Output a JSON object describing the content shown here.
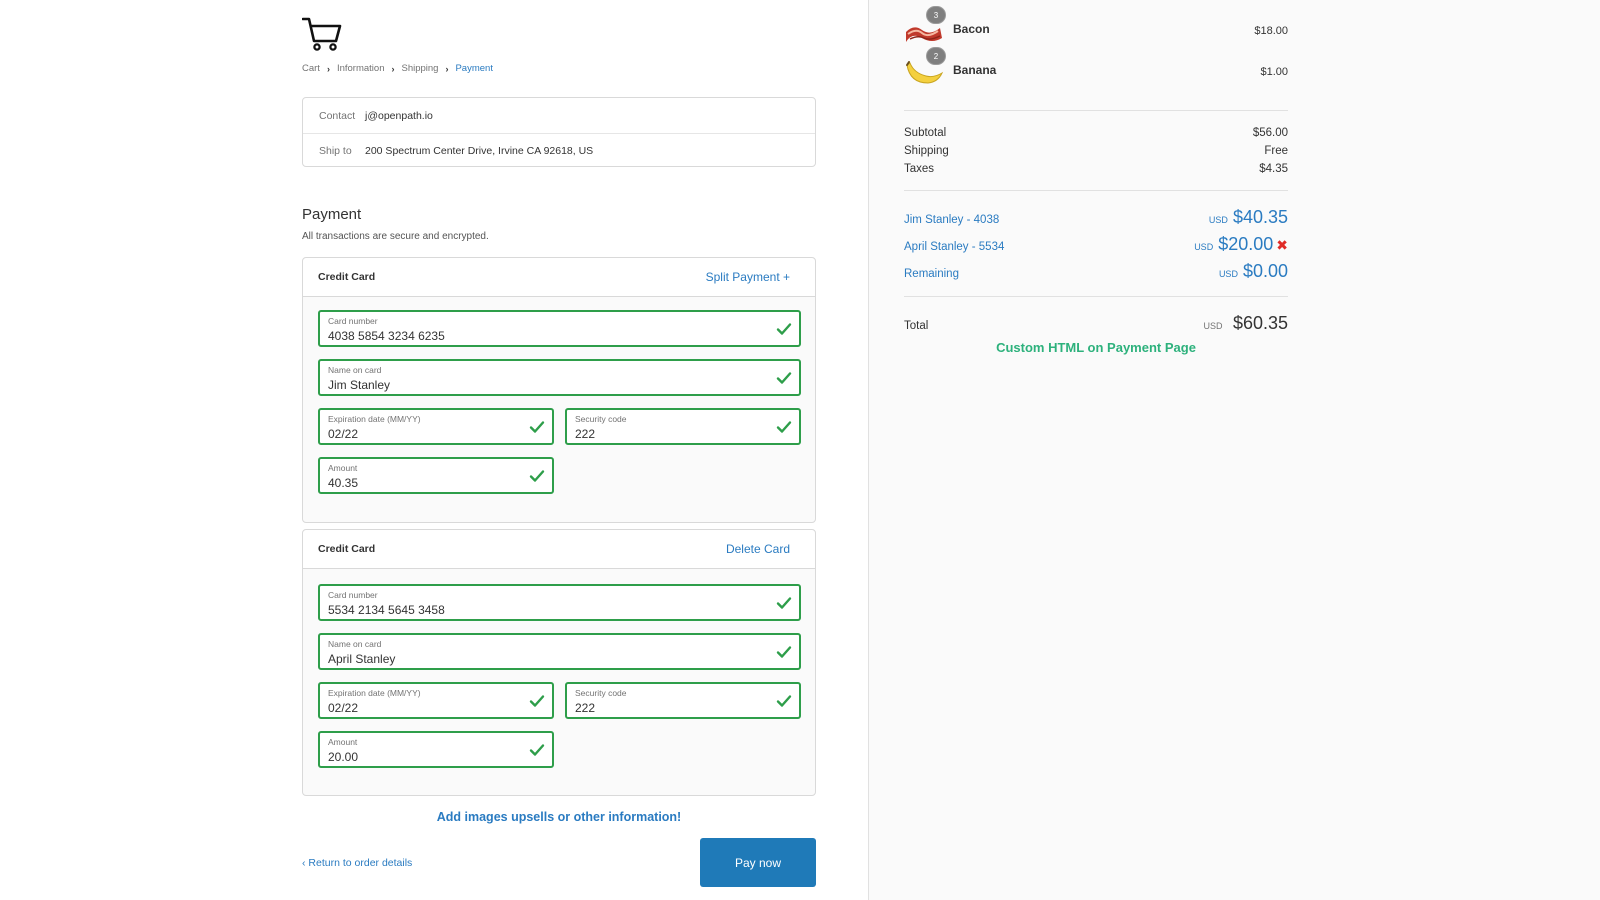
{
  "breadcrumb": [
    "Cart",
    "Information",
    "Shipping",
    "Payment"
  ],
  "review": {
    "contact_label": "Contact",
    "contact_value": "j@openpath.io",
    "shipto_label": "Ship to",
    "shipto_value": "200 Spectrum Center Drive, Irvine CA 92618, US"
  },
  "payment": {
    "title": "Payment",
    "subtitle": "All transactions are secure and encrypted."
  },
  "cards": [
    {
      "title": "Credit Card",
      "action": "Split Payment +",
      "card_number_label": "Card number",
      "card_number": "4038 5854 3234 6235",
      "name_label": "Name on card",
      "name": "Jim Stanley",
      "exp_label": "Expiration date (MM/YY)",
      "exp": "02/22",
      "cvv_label": "Security code",
      "cvv": "222",
      "amount_label": "Amount",
      "amount": "40.35"
    },
    {
      "title": "Credit Card",
      "action": "Delete Card",
      "card_number_label": "Card number",
      "card_number": "5534 2134 5645 3458",
      "name_label": "Name on card",
      "name": "April Stanley",
      "exp_label": "Expiration date (MM/YY)",
      "exp": "02/22",
      "cvv_label": "Security code",
      "cvv": "222",
      "amount_label": "Amount",
      "amount": "20.00"
    }
  ],
  "upsell_text": "Add images upsells or other information!",
  "return_link": "Return to order details",
  "pay_button": "Pay now",
  "products": [
    {
      "name": "Bacon",
      "qty": "3",
      "price": "$18.00"
    },
    {
      "name": "Banana",
      "qty": "2",
      "price": "$1.00"
    }
  ],
  "summary": {
    "subtotal_label": "Subtotal",
    "subtotal": "$56.00",
    "shipping_label": "Shipping",
    "shipping": "Free",
    "taxes_label": "Taxes",
    "taxes": "$4.35"
  },
  "payments": [
    {
      "label": "Jim Stanley - 4038",
      "currency": "USD",
      "amount": "$40.35"
    },
    {
      "label": "April Stanley - 5534",
      "currency": "USD",
      "amount": "$20.00",
      "remove": "✖"
    },
    {
      "label": "Remaining",
      "currency": "USD",
      "amount": "$0.00"
    }
  ],
  "total": {
    "label": "Total",
    "currency": "USD",
    "amount": "$60.35"
  },
  "custom_html": "Custom HTML on Payment Page",
  "colors": {
    "accent": "#2a7bc1",
    "success": "#2e9e4a",
    "button": "#1f7ab8",
    "custom": "#2db17c"
  }
}
